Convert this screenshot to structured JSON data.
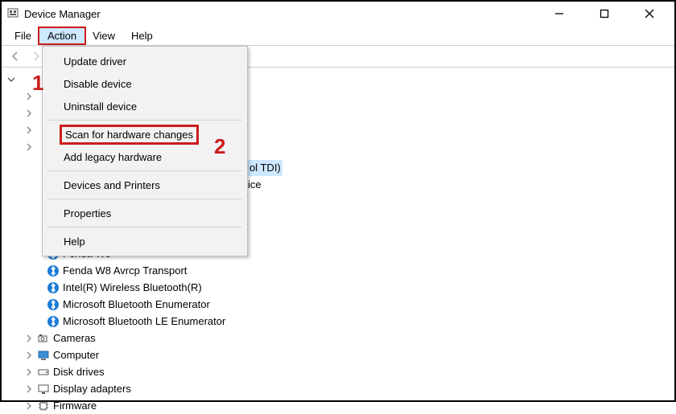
{
  "window": {
    "title": "Device Manager"
  },
  "menubar": {
    "items": [
      "File",
      "Action",
      "View",
      "Help"
    ],
    "active_index": 1
  },
  "action_menu": {
    "items": [
      "Update driver",
      "Disable device",
      "Uninstall device",
      "Scan for hardware changes",
      "Add legacy hardware",
      "Devices and Printers",
      "Properties",
      "Help"
    ]
  },
  "peek": {
    "partial1": "ol TDI)",
    "partial2": "ice"
  },
  "tree": {
    "bluetooth_children": [
      "Fenda W8",
      "Fenda W8 Avrcp Transport",
      "Intel(R) Wireless Bluetooth(R)",
      "Microsoft Bluetooth Enumerator",
      "Microsoft Bluetooth LE Enumerator"
    ],
    "siblings": [
      {
        "label": "Cameras",
        "icon": "camera"
      },
      {
        "label": "Computer",
        "icon": "monitor"
      },
      {
        "label": "Disk drives",
        "icon": "disk"
      },
      {
        "label": "Display adapters",
        "icon": "display"
      },
      {
        "label": "Firmware",
        "icon": "chip"
      }
    ]
  },
  "annotations": {
    "one": "1",
    "two": "2"
  }
}
